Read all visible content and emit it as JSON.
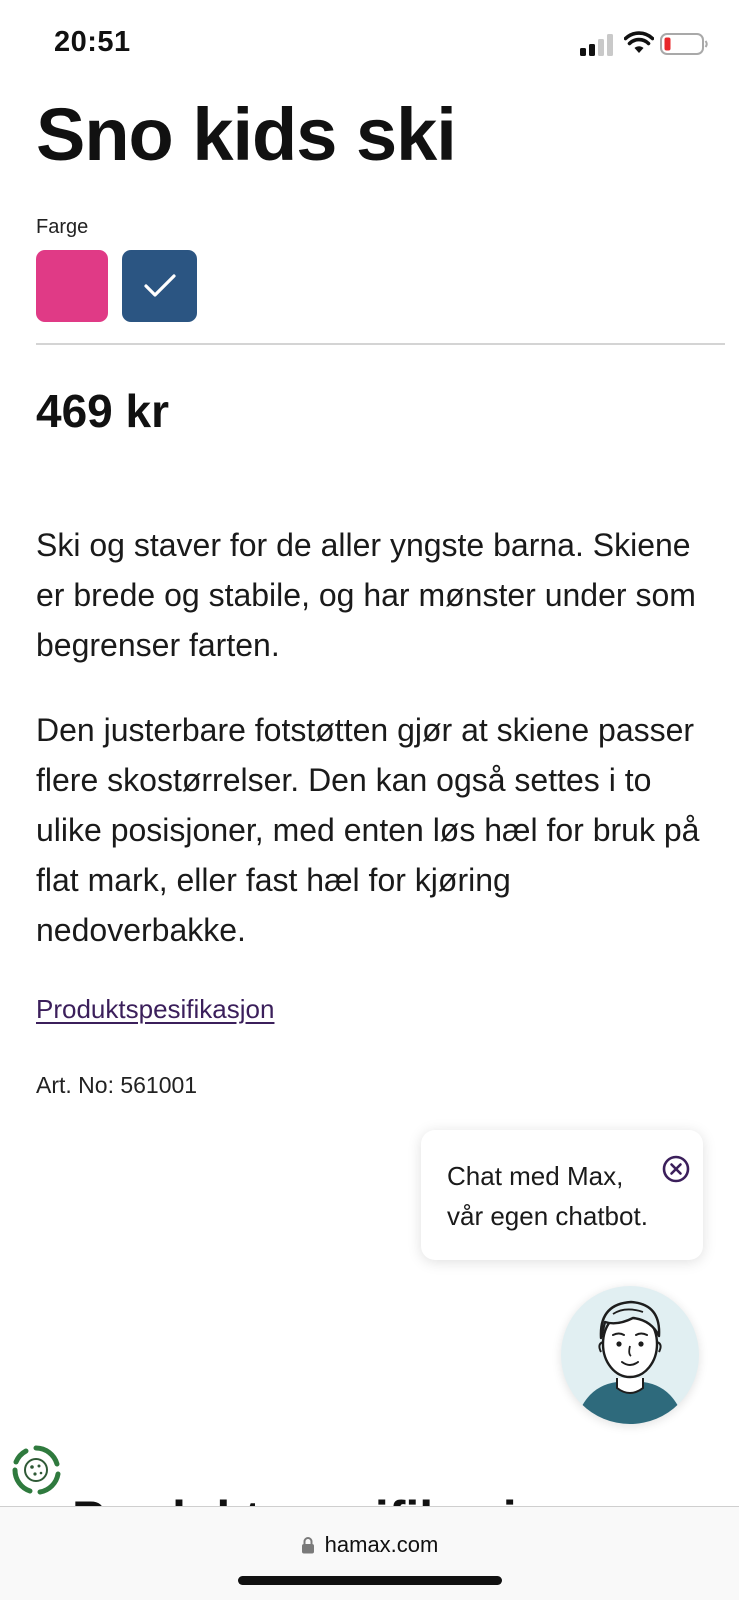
{
  "status_bar": {
    "time": "20:51",
    "icons": [
      "signal-icon",
      "wifi-icon",
      "battery-low-icon"
    ]
  },
  "product": {
    "title": "Sno kids ski",
    "color_label": "Farge",
    "colors": [
      {
        "name": "pink",
        "hex": "#e03a86",
        "selected": false
      },
      {
        "name": "blue",
        "hex": "#2b5582",
        "selected": true
      }
    ],
    "price": "469 kr",
    "description": [
      "Ski og staver for de aller yngste barna. Skiene er brede og stabile, og har mønster under som begrenser farten.",
      "Den justerbare fotstøtten gjør at skiene passer flere skostørrelser. Den kan også settes i to ulike posisjoner, med enten løs hæl for bruk på flat mark, eller fast hæl for kjøring nedoverbakke."
    ],
    "spec_link": "Produktspesifikasjon",
    "art_no": "Art. No: 561001"
  },
  "chat": {
    "bubble_line1": "Chat med Max,",
    "bubble_line2": "vår egen chatbot."
  },
  "cut_heading": "Produktspesifikasjon",
  "browser": {
    "url": "hamax.com"
  },
  "colors": {
    "accent_link": "#3b1f5b",
    "chat_avatar_bg": "#e1eff2",
    "avatar_shirt": "#2e6a7c"
  }
}
